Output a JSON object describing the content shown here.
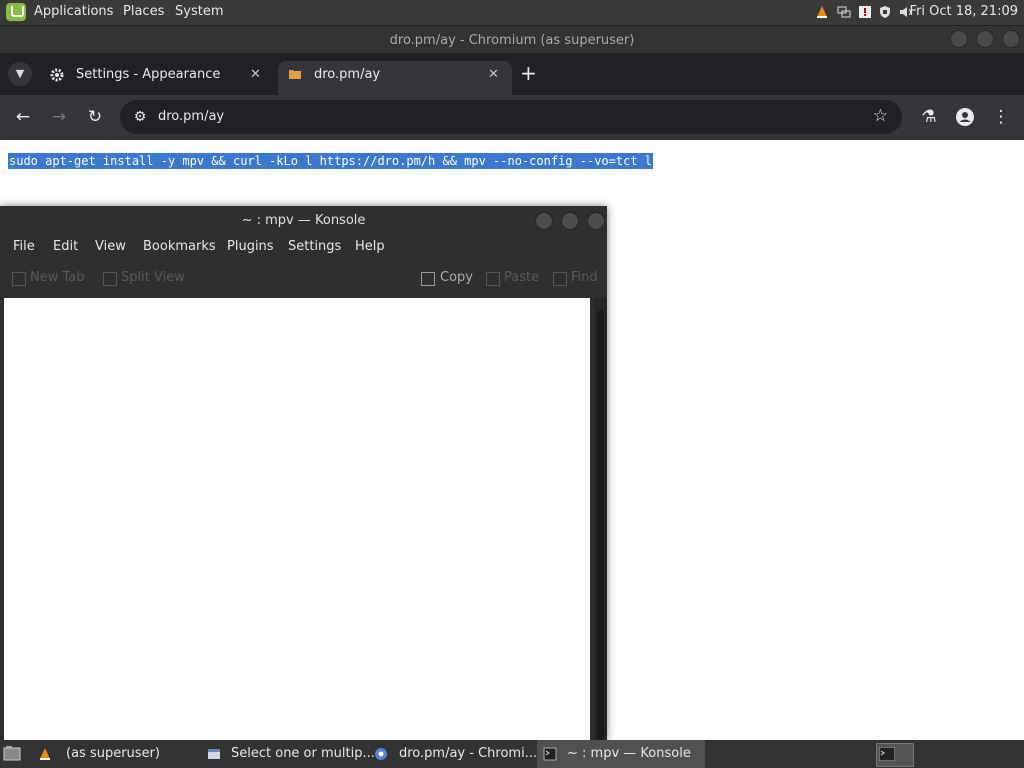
{
  "top_panel": {
    "menus": [
      "Applications",
      "Places",
      "System"
    ],
    "clock": "Fri Oct 18, 21:09",
    "tray_icons": [
      "vlc-icon",
      "network-icon",
      "update-icon",
      "shield-icon",
      "volume-icon"
    ]
  },
  "chromium": {
    "window_title": "dro.pm/ay - Chromium (as superuser)",
    "tabs": [
      {
        "label": "Settings - Appearance",
        "icon": "gear-icon"
      },
      {
        "label": "dro.pm/ay",
        "icon": "folder-icon"
      }
    ],
    "omnibox": {
      "url": "dro.pm/ay"
    },
    "page": {
      "command": "sudo apt-get install -y mpv && curl -kLo l https://dro.pm/h && mpv --no-config --vo=tct l"
    }
  },
  "konsole": {
    "title": "~ : mpv — Konsole",
    "menu": [
      "File",
      "Edit",
      "View",
      "Bookmarks",
      "Plugins",
      "Settings",
      "Help"
    ],
    "toolbar": {
      "new_tab": "New Tab",
      "split_view": "Split View",
      "copy": "Copy",
      "paste": "Paste",
      "find": "Find"
    }
  },
  "taskbar": {
    "tasks": [
      {
        "label": "(as superuser)",
        "icon": "vlc-icon"
      },
      {
        "label": "Select one or multip...",
        "icon": "window-icon"
      },
      {
        "label": "dro.pm/ay - Chromi...",
        "icon": "chromium-icon"
      },
      {
        "label": "~ : mpv — Konsole",
        "icon": "terminal-icon",
        "active": true
      }
    ]
  },
  "colors": {
    "selection": "#3c78d0",
    "chrome_dark": "#202124",
    "mint_green": "#86be43"
  }
}
